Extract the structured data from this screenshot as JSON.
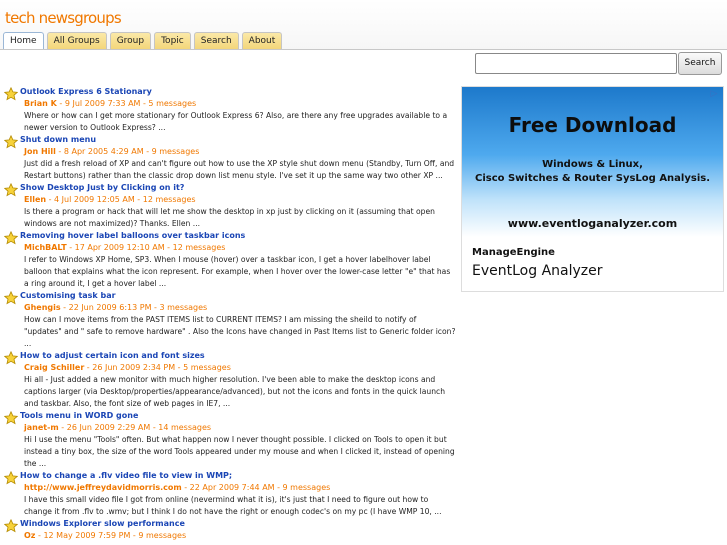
{
  "site": {
    "logo": "tech newsgroups"
  },
  "tabs": [
    {
      "label": "Home",
      "active": true
    },
    {
      "label": "All Groups"
    },
    {
      "label": "Group"
    },
    {
      "label": "Topic"
    },
    {
      "label": "Search"
    },
    {
      "label": "About"
    }
  ],
  "search": {
    "button_label": "Search",
    "value": ""
  },
  "ad": {
    "headline": "Free Download",
    "line1": "Windows & Linux,",
    "line2": "Cisco Switches & Router SysLog Analysis.",
    "url": "www.eventloganalyzer.com",
    "brand_small": "ManageEngine",
    "brand_big": "EventLog Analyzer",
    "badge": "▷"
  },
  "posts": [
    {
      "title": "Outlook Express 6 Stationary",
      "author": "Brian K",
      "meta": " - 9 Jul 2009 7:33 AM - 5 messages",
      "snippet": "Where or how can I get more stationary for Outlook Express 6?  Also, are there any free upgrades available to a newer version  to  Outlook Express? ..."
    },
    {
      "title": "Shut down menu",
      "author": "Jon Hill",
      "meta": " - 8 Apr 2005 4:29 AM - 9 messages",
      "snippet": "Just did a fresh reload of XP and can't figure out how to use the XP style shut down menu (Standby, Turn Off, and Restart buttons) rather than the classic drop down list menu style.  I've set it up the same way two other XP ..."
    },
    {
      "title": "Show Desktop Just by Clicking on it?",
      "author": "Ellen",
      "meta": " - 4 Jul 2009 12:05 AM - 12 messages",
      "snippet": "Is there a program or hack that will let me show the desktop in xp just by clicking on it (assuming that open windows are not maximized)? Thanks. Ellen ..."
    },
    {
      "title": "Removing hover label balloons over taskbar icons",
      "author": "MichBALT",
      "meta": " - 17 Apr 2009 12:10 AM - 12 messages",
      "snippet": "I refer to Windows XP Home, SP3. When I mouse (hover) over a taskbar icon, I get a hover labelhover label balloon that explains what the icon represent. For example, when I hover over the lower-case letter \"e\" that has a ring around it, I get a hover label ..."
    },
    {
      "title": "Customising task bar",
      "author": "Ghengis",
      "meta": " - 22 Jun 2009 6:13 PM - 3 messages",
      "snippet": "How can I move items from the PAST ITEMS list to CURRENT ITEMS? I am missing the sheild to notify of \"updates\" and \" safe to remove hardware\" . Also the Icons have changed in Past Items list to Generic folder icon? ..."
    },
    {
      "title": "How to adjust certain icon and font sizes",
      "author": "Craig Schiller",
      "meta": " - 26 Jun 2009 2:34 PM - 5 messages",
      "snippet": "Hi all - Just added a new monitor with much higher resolution. I've been able to make the desktop icons and captions larger (via Desktop/properties/appearance/advanced), but not the icons and fonts in the quick launch and taskbar. Also, the font size of  web pages in IE7, ..."
    },
    {
      "title": "Tools menu in WORD gone",
      "author": "janet-m",
      "meta": " - 26 Jun 2009 2:29 AM - 14 messages",
      "snippet": "Hi I use the menu \"Tools\" often. But what happen now I never thought possible. I clicked on Tools to open it but instead a tiny box, the size of the word Tools appeared under my mouse and when I clicked it, instead  of opening the ..."
    },
    {
      "title": "How to change a .flv video file to view in WMP;",
      "author": "http://www.jeffreydavidmorris.com",
      "meta": " - 22 Apr 2009 7:44 AM - 9 messages",
      "snippet": "I have this small video file I got from online (nevermind what it is), it's just that I need to figure out how to change it from .flv to .wmv; but I think I do not have the right or enough codec's on my pc (I have WMP 10, ..."
    },
    {
      "title": "Windows Explorer slow performance",
      "author": "Oz",
      "meta": " - 12 May 2009 7:59 PM - 9 messages",
      "snippet": ""
    }
  ]
}
